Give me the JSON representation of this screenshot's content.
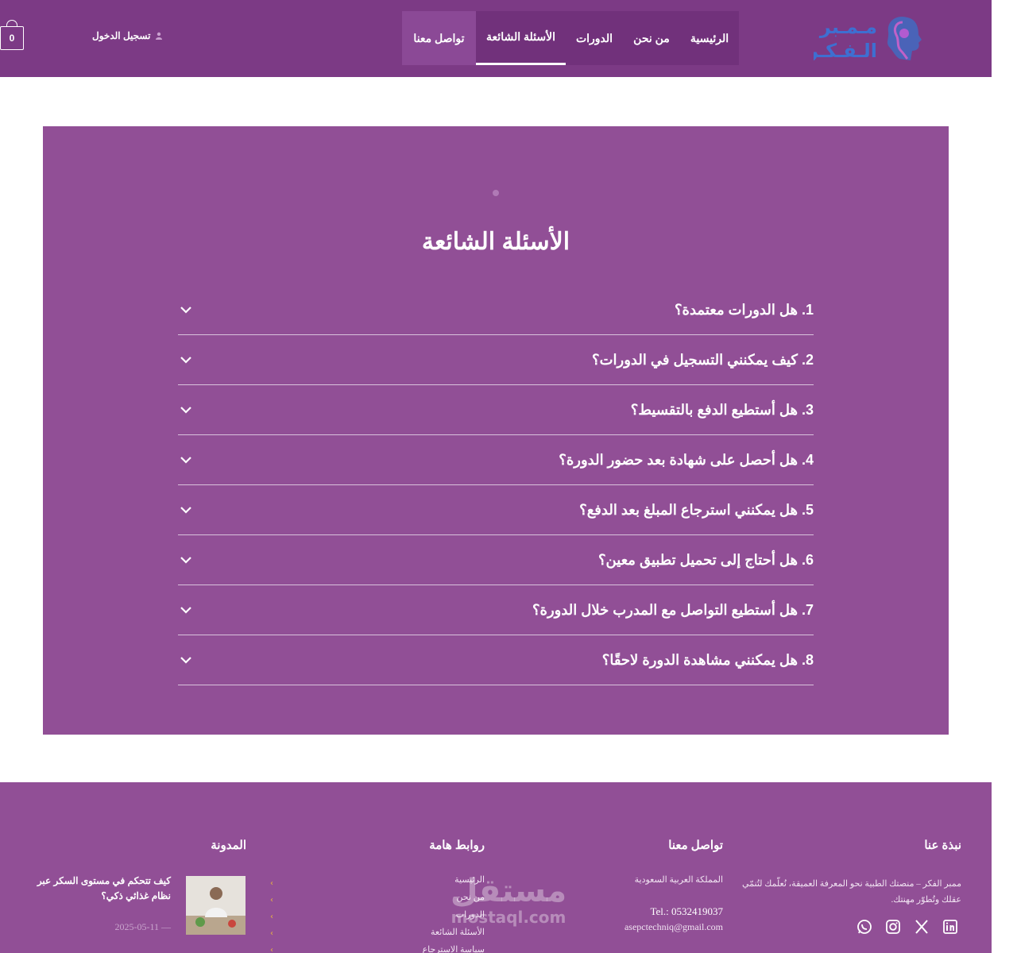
{
  "header": {
    "logo_line1": "مـمـبر",
    "logo_line2": "الـفـكـر",
    "nav": [
      "الرئيسية",
      "من نحن",
      "الدورات",
      "الأسئلة الشائعة",
      "تواصل معنا"
    ],
    "active_nav": "الأسئلة الشائعة",
    "login_label": "تسجيل الدخول",
    "cart_count": "0",
    "colors": {
      "header_bg": "#7c3a85",
      "accent": "#914f96"
    }
  },
  "faq": {
    "title": "الأسئلة الشائعة",
    "items": [
      "1. هل الدورات معتمدة؟",
      "2. كيف يمكنني التسجيل في الدورات؟",
      "3. هل أستطيع الدفع بالتقسيط؟",
      "4. هل أحصل على شهادة بعد حضور الدورة؟",
      "5. هل يمكنني استرجاع المبلغ بعد الدفع؟",
      "6. هل أحتاج إلى تحميل تطبيق معين؟",
      "7. هل أستطيع التواصل مع المدرب خلال الدورة؟",
      "8. هل يمكنني مشاهدة الدورة لاحقًا؟"
    ],
    "chevron_icon": "chevron-down-icon"
  },
  "footer": {
    "about": {
      "title": "نبذة عنا",
      "text1": "ممبر الفكر – منصتك الطبية نحو المعرفة العميقة، نُعلّمك لتُنمّي",
      "text2": "عقلك وتُطوّر مهنتك.",
      "socials": [
        "linkedin-icon",
        "x-icon",
        "instagram-icon",
        "whatsapp-icon"
      ]
    },
    "contact": {
      "title": "تواصل معنا",
      "country": "المملكة العربية السعودية",
      "tel": "Tel.: 0532419037",
      "email": "asepctechniq@gmail.com"
    },
    "links": {
      "title": "روابط هامة",
      "items": [
        "الرئيسية",
        "من نحن",
        "الدورات",
        "الأسئلة الشائعة",
        "سياسة الاسترجاع"
      ]
    },
    "blog": {
      "title": "المدونة",
      "post_title": "كيف تتحكم في مستوى السكر عبر نظام غذائي ذكي؟",
      "post_date": "2025-05-11 —"
    }
  },
  "watermark": {
    "line1": "مستقل",
    "line2": "mostaql.com"
  }
}
